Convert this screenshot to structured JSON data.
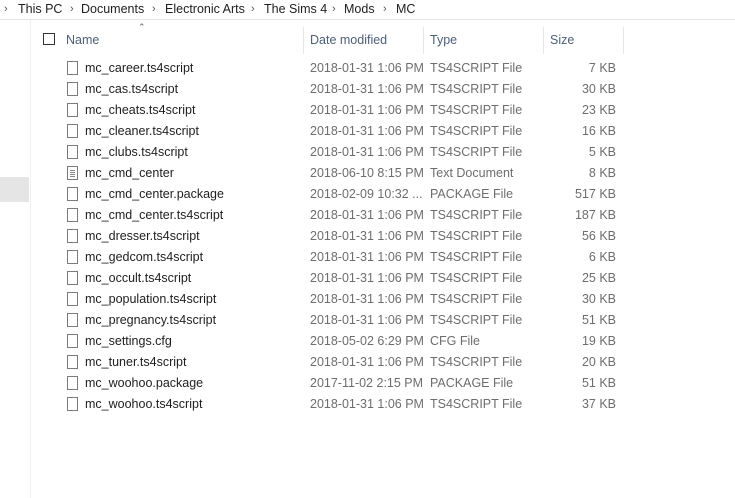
{
  "breadcrumb": {
    "items": [
      "This PC",
      "Documents",
      "Electronic Arts",
      "The Sims 4",
      "Mods",
      "MC"
    ],
    "separator_icon": "chevron-right-icon"
  },
  "columns": {
    "name": "Name",
    "date_modified": "Date modified",
    "type": "Type",
    "size": "Size",
    "sort_icon": "sort-up-icon"
  },
  "files": [
    {
      "name": "mc_career.ts4script",
      "date": "2018-01-31 1:06 PM",
      "type": "TS4SCRIPT File",
      "size": "7 KB",
      "icon": "file-icon"
    },
    {
      "name": "mc_cas.ts4script",
      "date": "2018-01-31 1:06 PM",
      "type": "TS4SCRIPT File",
      "size": "30 KB",
      "icon": "file-icon"
    },
    {
      "name": "mc_cheats.ts4script",
      "date": "2018-01-31 1:06 PM",
      "type": "TS4SCRIPT File",
      "size": "23 KB",
      "icon": "file-icon"
    },
    {
      "name": "mc_cleaner.ts4script",
      "date": "2018-01-31 1:06 PM",
      "type": "TS4SCRIPT File",
      "size": "16 KB",
      "icon": "file-icon"
    },
    {
      "name": "mc_clubs.ts4script",
      "date": "2018-01-31 1:06 PM",
      "type": "TS4SCRIPT File",
      "size": "5 KB",
      "icon": "file-icon"
    },
    {
      "name": "mc_cmd_center",
      "date": "2018-06-10 8:15 PM",
      "type": "Text Document",
      "size": "8 KB",
      "icon": "text-document-icon"
    },
    {
      "name": "mc_cmd_center.package",
      "date": "2018-02-09 10:32 ...",
      "type": "PACKAGE File",
      "size": "517 KB",
      "icon": "file-icon"
    },
    {
      "name": "mc_cmd_center.ts4script",
      "date": "2018-01-31 1:06 PM",
      "type": "TS4SCRIPT File",
      "size": "187 KB",
      "icon": "file-icon"
    },
    {
      "name": "mc_dresser.ts4script",
      "date": "2018-01-31 1:06 PM",
      "type": "TS4SCRIPT File",
      "size": "56 KB",
      "icon": "file-icon"
    },
    {
      "name": "mc_gedcom.ts4script",
      "date": "2018-01-31 1:06 PM",
      "type": "TS4SCRIPT File",
      "size": "6 KB",
      "icon": "file-icon"
    },
    {
      "name": "mc_occult.ts4script",
      "date": "2018-01-31 1:06 PM",
      "type": "TS4SCRIPT File",
      "size": "25 KB",
      "icon": "file-icon"
    },
    {
      "name": "mc_population.ts4script",
      "date": "2018-01-31 1:06 PM",
      "type": "TS4SCRIPT File",
      "size": "30 KB",
      "icon": "file-icon"
    },
    {
      "name": "mc_pregnancy.ts4script",
      "date": "2018-01-31 1:06 PM",
      "type": "TS4SCRIPT File",
      "size": "51 KB",
      "icon": "file-icon"
    },
    {
      "name": "mc_settings.cfg",
      "date": "2018-05-02 6:29 PM",
      "type": "CFG File",
      "size": "19 KB",
      "icon": "file-icon"
    },
    {
      "name": "mc_tuner.ts4script",
      "date": "2018-01-31 1:06 PM",
      "type": "TS4SCRIPT File",
      "size": "20 KB",
      "icon": "file-icon"
    },
    {
      "name": "mc_woohoo.package",
      "date": "2017-11-02 2:15 PM",
      "type": "PACKAGE File",
      "size": "51 KB",
      "icon": "file-icon"
    },
    {
      "name": "mc_woohoo.ts4script",
      "date": "2018-01-31 1:06 PM",
      "type": "TS4SCRIPT File",
      "size": "37 KB",
      "icon": "file-icon"
    }
  ]
}
